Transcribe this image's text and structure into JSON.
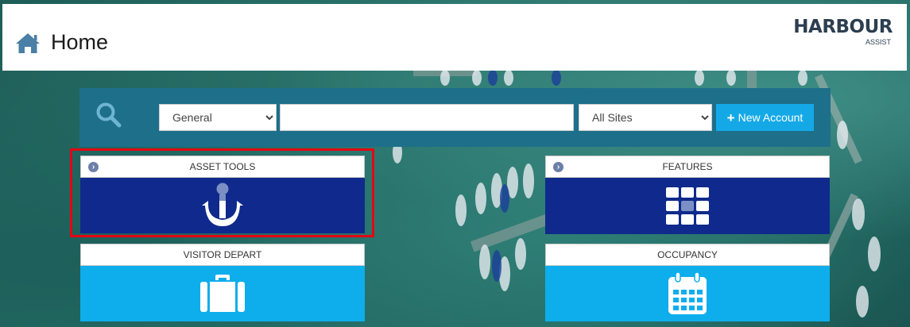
{
  "header": {
    "title": "Home",
    "logo_main": "HARBOUR",
    "logo_sub": "ASSIST"
  },
  "search": {
    "type_selected": "General",
    "type_options": [
      "General"
    ],
    "query_value": "",
    "sites_selected": "All Sites",
    "sites_options": [
      "All Sites"
    ],
    "new_account_label": "New Account"
  },
  "tiles": {
    "asset_tools": {
      "label": "ASSET TOOLS",
      "icon": "anchor-icon",
      "color": "#0f2a8c"
    },
    "features": {
      "label": "FEATURES",
      "icon": "grid-icon",
      "color": "#0f2a8c"
    },
    "visitor_depart": {
      "label": "VISITOR DEPART",
      "icon": "suitcase-icon",
      "color": "#0daeeb"
    },
    "occupancy": {
      "label": "OCCUPANCY",
      "icon": "calendar-icon",
      "color": "#0daeeb"
    }
  },
  "colors": {
    "search_bar": "#1d6f8a",
    "button_accent": "#14a9e6",
    "highlight": "#e30613"
  }
}
